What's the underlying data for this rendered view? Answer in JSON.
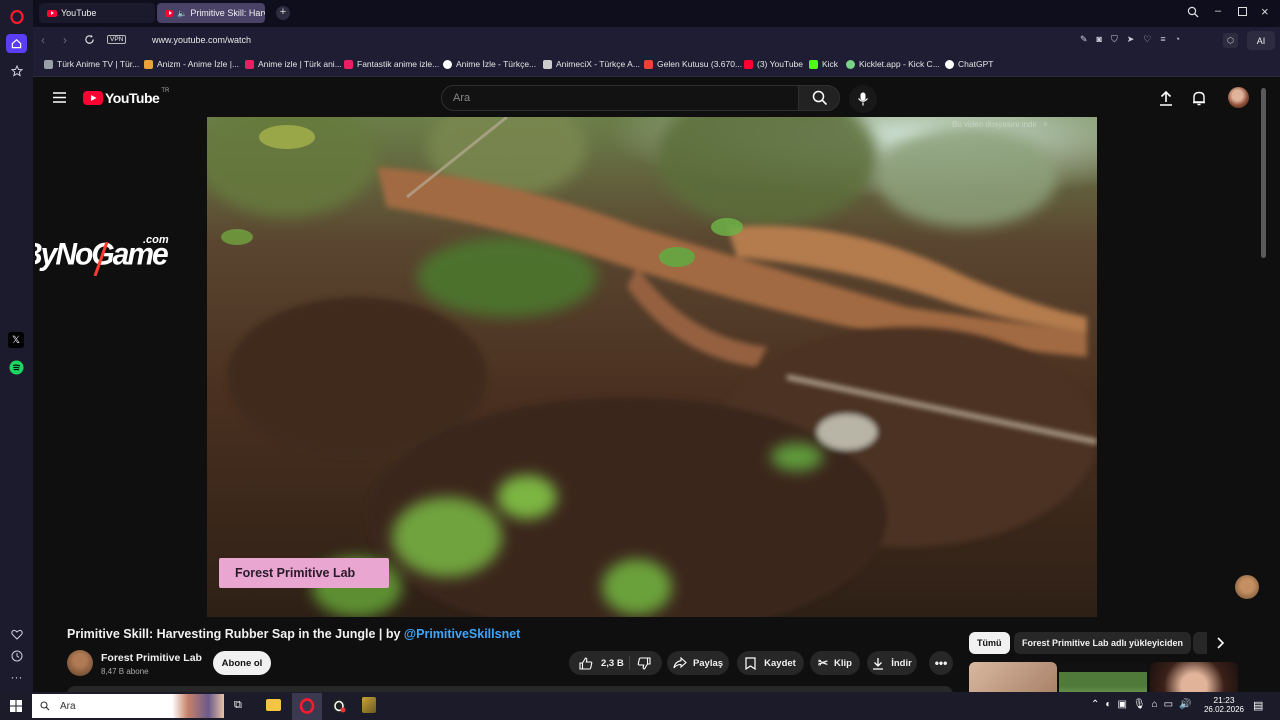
{
  "browser": {
    "tabs": [
      {
        "label": "YouTube"
      },
      {
        "label": "Primitive Skill: Harvest"
      }
    ],
    "url": "www.youtube.com/watch",
    "vpn_label": "VPN",
    "ai_label": "AI",
    "bookmarks": [
      {
        "label": "Türk Anime TV | Tür...",
        "color": "#9aa0a6"
      },
      {
        "label": "Anizm - Anime İzle |...",
        "color": "#e8a33d"
      },
      {
        "label": "Anime izle | Türk ani...",
        "color": "#e91e63"
      },
      {
        "label": "Fantastik anime izle...",
        "color": "#e91e63"
      },
      {
        "label": "Anime İzle - Türkçe...",
        "color": "#ffffff"
      },
      {
        "label": "AnimeciX - Türkçe A...",
        "color": "#cccccc"
      },
      {
        "label": "Gelen Kutusu (3.670...",
        "color": "#ea4335"
      },
      {
        "label": "(3) YouTube",
        "color": "#ff0033"
      },
      {
        "label": "Kick",
        "color": "#53fc18"
      },
      {
        "label": "Kicklet.app - Kick C...",
        "color": "#7bd389"
      },
      {
        "label": "ChatGPT",
        "color": "#ffffff"
      }
    ]
  },
  "youtube": {
    "logo_text": "YouTube",
    "region": "TR",
    "search_placeholder": "Ara",
    "video": {
      "overlay_top": "Bu video dosyasını indir",
      "overlay_close": "×",
      "watermark": "Forest Primitive Lab",
      "byno_text": "ByNoGame",
      "byno_domain": ".com"
    },
    "title_main": "Primitive Skill: Harvesting Rubber Sap in the Jungle | by ",
    "title_handle": "@PrimitiveSkillsnet",
    "channel": {
      "name": "Forest Primitive Lab",
      "subscribers": "8,47 B abone",
      "subscribe_label": "Abone ol"
    },
    "actions": {
      "likes": "2,3 B",
      "share": "Paylaş",
      "save": "Kaydet",
      "clip": "Klip",
      "download": "İndir"
    },
    "chips": [
      {
        "label": "Tümü"
      },
      {
        "label": "Forest Primitive Lab adlı yükleyiciden"
      }
    ]
  },
  "taskbar": {
    "search_placeholder": "Ara",
    "time": "21:23",
    "date": "26.02.2026"
  },
  "colors": {
    "youtube_red": "#ff0033",
    "link_blue": "#3ea6ff",
    "opera_red": "#ff1b2d"
  }
}
